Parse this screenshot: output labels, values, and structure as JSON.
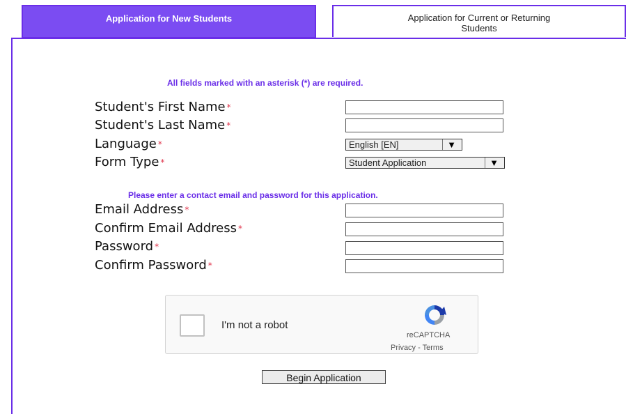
{
  "tabs": {
    "new_students": "Application for New Students",
    "current_students_line1": "Application for Current or Returning",
    "current_students_line2": "Students"
  },
  "form": {
    "required_note": "All fields marked with an asterisk (*) are required.",
    "contact_note": "Please enter a contact email and password for this application.",
    "required_marker": "*",
    "first_name_label": "Student's First Name",
    "last_name_label": "Student's Last Name",
    "language_label": "Language",
    "form_type_label": "Form Type",
    "email_label": "Email Address",
    "confirm_email_label": "Confirm Email Address",
    "password_label": "Password",
    "confirm_password_label": "Confirm Password",
    "language_value": "English [EN]",
    "form_type_value": "Student Application",
    "first_name_value": "",
    "last_name_value": "",
    "email_value": "",
    "confirm_email_value": "",
    "password_value": "",
    "confirm_password_value": ""
  },
  "captcha": {
    "label": "I'm not a robot",
    "brand": "reCAPTCHA",
    "links": "Privacy - Terms",
    "checked": false
  },
  "submit_label": "Begin Application",
  "colors": {
    "accent": "#7b4cf2",
    "border": "#6a2ee8",
    "required": "#e0344b"
  },
  "icons": {
    "dropdown": "triangle-down-icon",
    "captcha_logo": "recaptcha-logo-icon"
  }
}
